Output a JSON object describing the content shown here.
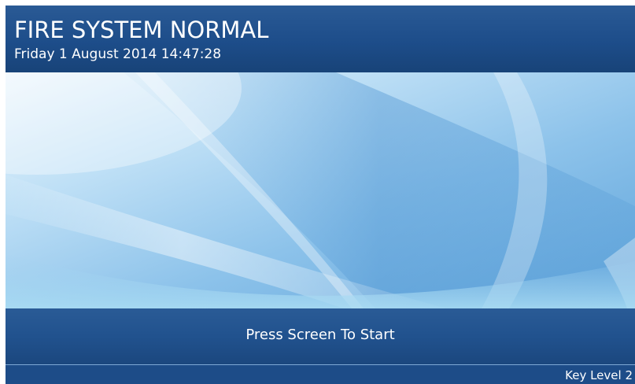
{
  "header": {
    "status_title": "FIRE SYSTEM NORMAL",
    "datetime": "Friday 1 August 2014 14:47:28"
  },
  "main": {
    "start_prompt": "Press Screen To Start"
  },
  "footer": {
    "key_level": "Key Level 2"
  },
  "colors": {
    "header_bg": "#1d4d8a",
    "bar_bg": "#21528e",
    "text": "#ffffff",
    "wallpaper_light": "#e6f3fc",
    "wallpaper_mid": "#8fc3ec",
    "wallpaper_dark": "#4f95d2"
  }
}
